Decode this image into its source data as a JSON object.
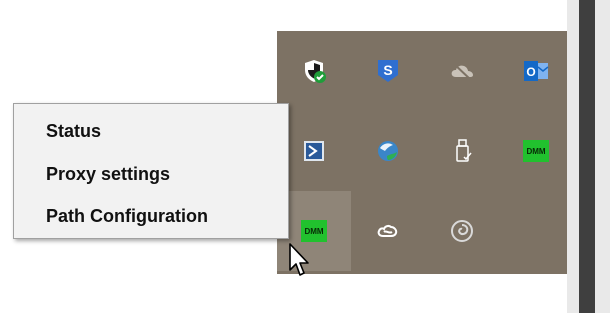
{
  "context_menu": {
    "items": [
      {
        "label": "Status"
      },
      {
        "label": "Proxy settings"
      },
      {
        "label": "Path Configuration"
      }
    ]
  },
  "tray_overflow": {
    "icons": [
      {
        "name": "windows-security-icon"
      },
      {
        "name": "sophos-s-icon"
      },
      {
        "name": "onedrive-cloud-icon"
      },
      {
        "name": "outlook-icon"
      },
      {
        "name": "powershell-icon"
      },
      {
        "name": "network-globe-icon"
      },
      {
        "name": "usb-drive-icon"
      },
      {
        "name": "dmm-icon",
        "label": "DMM"
      },
      {
        "name": "dmm-icon",
        "label": "DMM"
      },
      {
        "name": "creative-cloud-icon"
      },
      {
        "name": "spiral-icon"
      }
    ],
    "background": "#7d7264"
  }
}
